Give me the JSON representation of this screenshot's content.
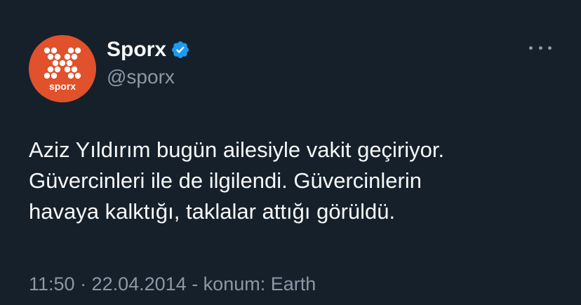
{
  "author": {
    "display_name": "Sporx",
    "handle": "@sporx",
    "avatar_text": "sporx",
    "verified": true
  },
  "tweet": {
    "lines": [
      "Aziz Yıldırım bugün ailesiyle vakit geçiriyor.",
      "Güvercinleri ile de ilgilendi. Güvercinlerin",
      "havaya kalktığı, taklalar attığı görüldü."
    ],
    "timestamp": "11:50 · 22.04.2014 - konum: Earth"
  },
  "icons": {
    "verified": "verified-badge-icon",
    "more": "more-options-icon"
  },
  "colors": {
    "background": "#15202b",
    "avatar": "#e0512c",
    "verified": "#1d9bf0",
    "secondary_text": "#8b98a5",
    "primary_text": "#f7f9f9"
  }
}
